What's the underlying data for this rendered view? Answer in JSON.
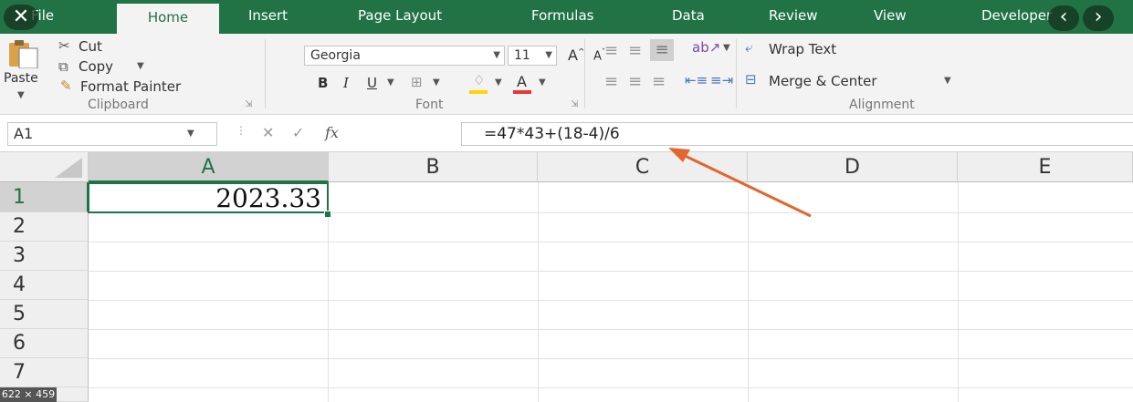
{
  "tabs": [
    "File",
    "Home",
    "Insert",
    "Page Layout",
    "Formulas",
    "Data",
    "Review",
    "View",
    "Developer"
  ],
  "active_tab": "Home",
  "clipboard": {
    "paste": "Paste",
    "cut": "Cut",
    "copy": "Copy",
    "format_painter": "Format Painter",
    "group": "Clipboard"
  },
  "font": {
    "name": "Georgia",
    "size": "11",
    "bold": "B",
    "italic": "I",
    "underline": "U",
    "group": "Font",
    "font_color": "#e53935",
    "fill_color": "#ffd400"
  },
  "alignment": {
    "wrap_text": "Wrap Text",
    "merge_center": "Merge & Center",
    "group": "Alignment"
  },
  "formula_bar": {
    "name_box": "A1",
    "fx": "fx",
    "formula": "=47*43+(18-4)/6"
  },
  "columns": [
    "A",
    "B",
    "C",
    "D",
    "E"
  ],
  "rows": [
    "1",
    "2",
    "3",
    "4",
    "5",
    "6",
    "7"
  ],
  "cells": {
    "A1": "2023.33"
  },
  "image_size_label": "622 × 459",
  "accent": "#217346",
  "arrow_color": "#e2662f"
}
